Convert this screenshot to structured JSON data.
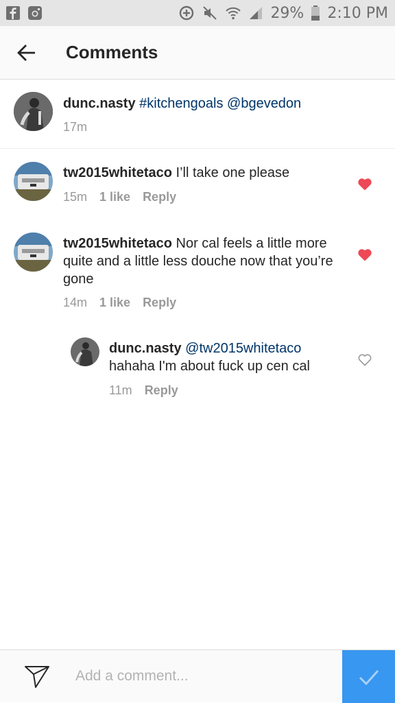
{
  "status_bar": {
    "battery": "29%",
    "time": "2:10 PM"
  },
  "header": {
    "title": "Comments"
  },
  "caption": {
    "username": "dunc.nasty",
    "hashtag": "#kitchengoals",
    "mention": "@bgevedon",
    "time": "17m"
  },
  "comments": [
    {
      "username": "tw2015whitetaco",
      "text": "I’ll take one please",
      "time": "15m",
      "likes": "1 like",
      "reply": "Reply",
      "liked": true
    },
    {
      "username": "tw2015whitetaco",
      "text": "Nor cal feels a little more quite and a little less douche now that you’re gone",
      "time": "14m",
      "likes": "1 like",
      "reply": "Reply",
      "liked": true
    },
    {
      "username": "dunc.nasty",
      "mention": "@tw2015whitetaco",
      "text": "hahaha I'm about fuck up cen cal",
      "time": "11m",
      "reply": "Reply",
      "liked": false
    }
  ],
  "composer": {
    "placeholder": "Add a comment..."
  },
  "colors": {
    "heart_active": "#ed4956",
    "link": "#003569",
    "post_button": "#3897f0",
    "meta_text": "#999999"
  }
}
